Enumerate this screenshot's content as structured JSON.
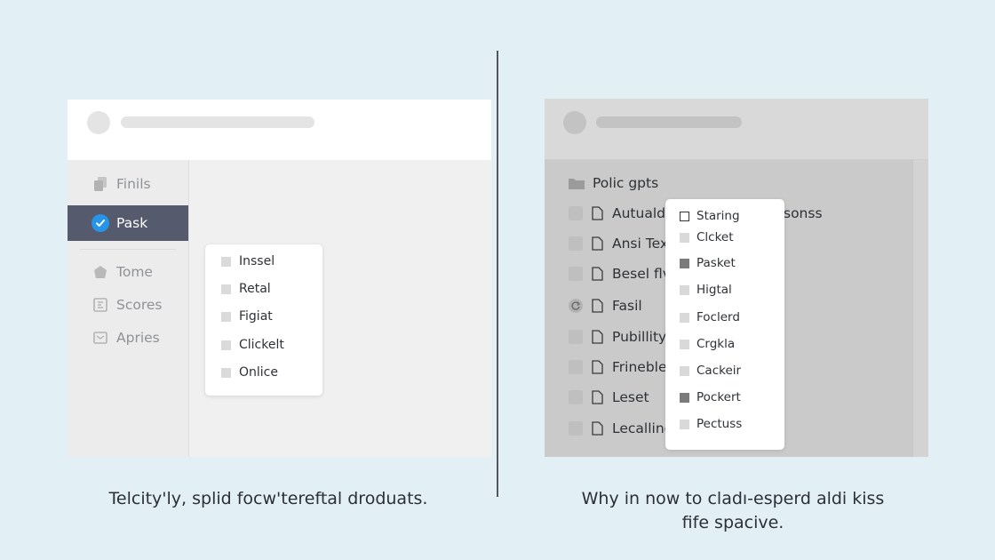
{
  "divider": {},
  "left_panel": {
    "sidebar": [
      {
        "label": "Finils",
        "icon": "stack-icon"
      },
      {
        "label": "Pask",
        "icon": "check-circle-icon",
        "active": true
      },
      {
        "label": "Tome",
        "icon": "home-icon"
      },
      {
        "label": "Scores",
        "icon": "grid-icon"
      },
      {
        "label": "Apries",
        "icon": "inbox-icon"
      }
    ],
    "popup_items": [
      "Inssel",
      "Retal",
      "Figiat",
      "Clickelt",
      "Onlice"
    ],
    "caption": "Telcity'ly, splid focw'tereftal droduats."
  },
  "right_panel": {
    "rows": [
      {
        "label": "Polic gpts",
        "icon": "folder-icon"
      },
      {
        "label": "Autualds",
        "trailing": "sonss",
        "icon": "file-icon"
      },
      {
        "label": "Ansi Text",
        "icon": "file-icon"
      },
      {
        "label": "Besel flv",
        "icon": "file-icon"
      },
      {
        "label": "Fasil",
        "icon": "file-icon",
        "status": "refresh-icon"
      },
      {
        "label": "Pubillity",
        "icon": "file-icon"
      },
      {
        "label": "Frinebler",
        "icon": "file-icon"
      },
      {
        "label": "Leset",
        "icon": "file-icon"
      },
      {
        "label": "Lecalline",
        "icon": "file-icon"
      }
    ],
    "popup_items": [
      {
        "label": "Staring",
        "marker": "open"
      },
      {
        "label": "Clcket",
        "marker": "light"
      },
      {
        "label": "Pasket",
        "marker": "dark"
      },
      {
        "label": "Higtal",
        "marker": "light"
      },
      {
        "label": "Foclerd",
        "marker": "light"
      },
      {
        "label": "Crgkla",
        "marker": "light"
      },
      {
        "label": "Cackeir",
        "marker": "light"
      },
      {
        "label": "Pockert",
        "marker": "dark"
      },
      {
        "label": "Pectuss",
        "marker": "light"
      }
    ],
    "caption_line1": "Why in now to cladı-esperd aldi kiss",
    "caption_line2": "fife spacive."
  },
  "colors": {
    "background": "#e2f0f6",
    "active_sidebar": "#555b6c",
    "accent_check": "#2694e8",
    "divider": "#55595f"
  }
}
